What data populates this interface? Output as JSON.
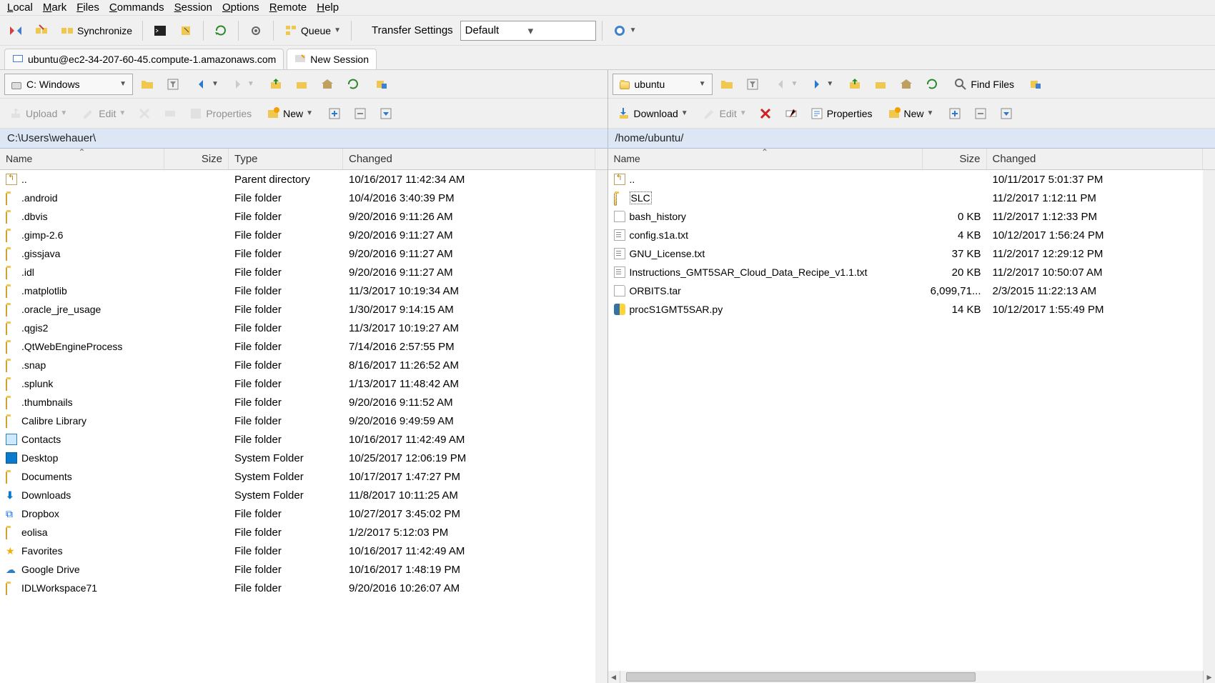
{
  "menu": [
    "Local",
    "Mark",
    "Files",
    "Commands",
    "Session",
    "Options",
    "Remote",
    "Help"
  ],
  "toolbar": {
    "synchronize": "Synchronize",
    "queue": "Queue",
    "transfer_settings": "Transfer Settings",
    "transfer_default": "Default"
  },
  "sessions": {
    "active": "ubuntu@ec2-34-207-60-45.compute-1.amazonaws.com",
    "new": "New Session"
  },
  "left": {
    "drive": "C: Windows",
    "path": "C:\\Users\\wehauer\\",
    "actions": {
      "upload": "Upload",
      "edit": "Edit",
      "properties": "Properties",
      "new": "New"
    },
    "headers": {
      "name": "Name",
      "size": "Size",
      "type": "Type",
      "changed": "Changed"
    },
    "rows": [
      {
        "icon": "up",
        "name": "..",
        "size": "",
        "type": "Parent directory",
        "changed": "10/16/2017  11:42:34 AM"
      },
      {
        "icon": "folder",
        "name": ".android",
        "size": "",
        "type": "File folder",
        "changed": "10/4/2016  3:40:39 PM"
      },
      {
        "icon": "folder",
        "name": ".dbvis",
        "size": "",
        "type": "File folder",
        "changed": "9/20/2016  9:11:26 AM"
      },
      {
        "icon": "folder",
        "name": ".gimp-2.6",
        "size": "",
        "type": "File folder",
        "changed": "9/20/2016  9:11:27 AM"
      },
      {
        "icon": "folder",
        "name": ".gissjava",
        "size": "",
        "type": "File folder",
        "changed": "9/20/2016  9:11:27 AM"
      },
      {
        "icon": "folder",
        "name": ".idl",
        "size": "",
        "type": "File folder",
        "changed": "9/20/2016  9:11:27 AM"
      },
      {
        "icon": "folder",
        "name": ".matplotlib",
        "size": "",
        "type": "File folder",
        "changed": "11/3/2017  10:19:34 AM"
      },
      {
        "icon": "folder",
        "name": ".oracle_jre_usage",
        "size": "",
        "type": "File folder",
        "changed": "1/30/2017  9:14:15 AM"
      },
      {
        "icon": "folder",
        "name": ".qgis2",
        "size": "",
        "type": "File folder",
        "changed": "11/3/2017  10:19:27 AM"
      },
      {
        "icon": "folder",
        "name": ".QtWebEngineProcess",
        "size": "",
        "type": "File folder",
        "changed": "7/14/2016  2:57:55 PM"
      },
      {
        "icon": "folder",
        "name": ".snap",
        "size": "",
        "type": "File folder",
        "changed": "8/16/2017  11:26:52 AM"
      },
      {
        "icon": "folder",
        "name": ".splunk",
        "size": "",
        "type": "File folder",
        "changed": "1/13/2017  11:48:42 AM"
      },
      {
        "icon": "folder",
        "name": ".thumbnails",
        "size": "",
        "type": "File folder",
        "changed": "9/20/2016  9:11:52 AM"
      },
      {
        "icon": "folder",
        "name": "Calibre Library",
        "size": "",
        "type": "File folder",
        "changed": "9/20/2016  9:49:59 AM"
      },
      {
        "icon": "contacts",
        "name": "Contacts",
        "size": "",
        "type": "File folder",
        "changed": "10/16/2017  11:42:49 AM"
      },
      {
        "icon": "desktop",
        "name": "Desktop",
        "size": "",
        "type": "System Folder",
        "changed": "10/25/2017  12:06:19 PM"
      },
      {
        "icon": "folder",
        "name": "Documents",
        "size": "",
        "type": "System Folder",
        "changed": "10/17/2017  1:47:27 PM"
      },
      {
        "icon": "down",
        "name": "Downloads",
        "size": "",
        "type": "System Folder",
        "changed": "11/8/2017  10:11:25 AM"
      },
      {
        "icon": "dropbox",
        "name": "Dropbox",
        "size": "",
        "type": "File folder",
        "changed": "10/27/2017  3:45:02 PM"
      },
      {
        "icon": "folder",
        "name": "eolisa",
        "size": "",
        "type": "File folder",
        "changed": "1/2/2017  5:12:03 PM"
      },
      {
        "icon": "star",
        "name": "Favorites",
        "size": "",
        "type": "File folder",
        "changed": "10/16/2017  11:42:49 AM"
      },
      {
        "icon": "cloud",
        "name": "Google Drive",
        "size": "",
        "type": "File folder",
        "changed": "10/16/2017  1:48:19 PM"
      },
      {
        "icon": "folder",
        "name": "IDLWorkspace71",
        "size": "",
        "type": "File folder",
        "changed": "9/20/2016  10:26:07 AM"
      }
    ]
  },
  "right": {
    "drive": "ubuntu",
    "path": "/home/ubuntu/",
    "actions": {
      "download": "Download",
      "edit": "Edit",
      "properties": "Properties",
      "new": "New",
      "find": "Find Files"
    },
    "headers": {
      "name": "Name",
      "size": "Size",
      "changed": "Changed"
    },
    "rows": [
      {
        "icon": "up",
        "name": "..",
        "size": "",
        "changed": "10/11/2017 5:01:37 PM"
      },
      {
        "icon": "folder",
        "name": "SLC",
        "size": "",
        "changed": "11/2/2017 1:12:11 PM",
        "selected": true
      },
      {
        "icon": "file",
        "name": "bash_history",
        "size": "0 KB",
        "changed": "11/2/2017 1:12:33 PM"
      },
      {
        "icon": "txt",
        "name": "config.s1a.txt",
        "size": "4 KB",
        "changed": "10/12/2017 1:56:24 PM"
      },
      {
        "icon": "txt",
        "name": "GNU_License.txt",
        "size": "37 KB",
        "changed": "11/2/2017 12:29:12 PM"
      },
      {
        "icon": "txt",
        "name": "Instructions_GMT5SAR_Cloud_Data_Recipe_v1.1.txt",
        "size": "20 KB",
        "changed": "11/2/2017 10:50:07 AM"
      },
      {
        "icon": "file",
        "name": "ORBITS.tar",
        "size": "6,099,71...",
        "changed": "2/3/2015 11:22:13 AM"
      },
      {
        "icon": "py",
        "name": "procS1GMT5SAR.py",
        "size": "14 KB",
        "changed": "10/12/2017 1:55:49 PM"
      }
    ]
  }
}
